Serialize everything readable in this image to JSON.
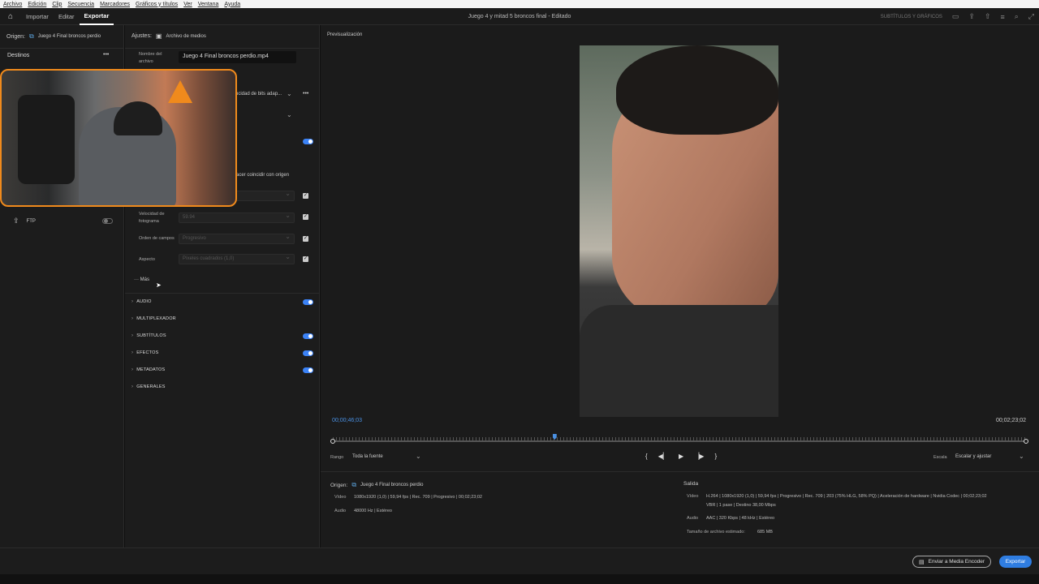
{
  "menu": [
    "Archivo",
    "Edición",
    "Clip",
    "Secuencia",
    "Marcadores",
    "Gráficos y títulos",
    "Ver",
    "Ventana",
    "Ayuda"
  ],
  "tabs": {
    "import": "Importar",
    "edit": "Editar",
    "export": "Exportar"
  },
  "doc_title": "Juego 4 y mitad 5 broncos final - Editado",
  "top_right_label": "SUBTÍTULOS Y GRÁFICOS",
  "left": {
    "origin_label": "Origen:",
    "origin_value": "Juego 4 Final broncos perdio",
    "destinations": "Destinos",
    "more": "•••",
    "ftp": "FTP"
  },
  "mid": {
    "settings_label": "Ajustes:",
    "settings_value": "Archivo de medios",
    "filename_label": "Nombre del archivo",
    "filename_value": "Juego 4 Final broncos perdio.mp4",
    "bitrate_partial": "ocidad de bits adap...",
    "match_source": "acer coincidir con origen",
    "frame_rate_label": "Velocidad de fotograma",
    "frame_rate_value": "59.94",
    "field_order_label": "Orden de campos",
    "field_order_value": "Progresivo",
    "aspect_label": "Aspecto",
    "aspect_value": "Píxeles cuadrados (1,0)",
    "more": "··· Más",
    "sections": [
      "AUDIO",
      "MULTIPLEXADOR",
      "SUBTÍTULOS",
      "EFECTOS",
      "METADATOS",
      "GENERALES"
    ]
  },
  "preview": {
    "label": "Previsualización",
    "timecode_current": "00;00;46;03",
    "timecode_end": "00;02;23;02",
    "playhead_fraction": 0.32,
    "range_label": "Rango",
    "range_value": "Toda la fuente",
    "scale_label": "Escala",
    "scale_value": "Escalar y ajustar"
  },
  "source_info": {
    "title": "Origen:",
    "name": "Juego 4 Final broncos perdio",
    "video_label": "Vídeo",
    "video_value": "1080x1920 (1,0)  |  59,94 fps  |  Rec. 709  |  Progresivo  |  00;02;23;02",
    "audio_label": "Audio",
    "audio_value": "48000 Hz  |  Estéreo"
  },
  "output_info": {
    "title": "Salida",
    "video_label": "Vídeo",
    "video_line1": "H.264  |  1080x1920 (1,0)  |  59,94 fps  |  Progresivo  |  Rec. 709  |  203 (75% HLG, 58% PQ)  |  Aceleración de hardware  |  Nvidia Codec  |  00;02;23;02",
    "video_line2": "VBR  |  1 pase  |  Destino 38,00 Mbps",
    "audio_label": "Audio",
    "audio_value": "AAC  |  320 Kbps  |  48 kHz  |  Estéreo",
    "size_label": "Tamaño de archivo estimado:",
    "size_value": "685 MB"
  },
  "footer": {
    "media_encoder": "Enviar a Media Encoder",
    "export": "Exportar"
  },
  "colors": {
    "accent": "#2f7de1",
    "toggle": "#3b82f6",
    "orange": "#f08a1c"
  }
}
